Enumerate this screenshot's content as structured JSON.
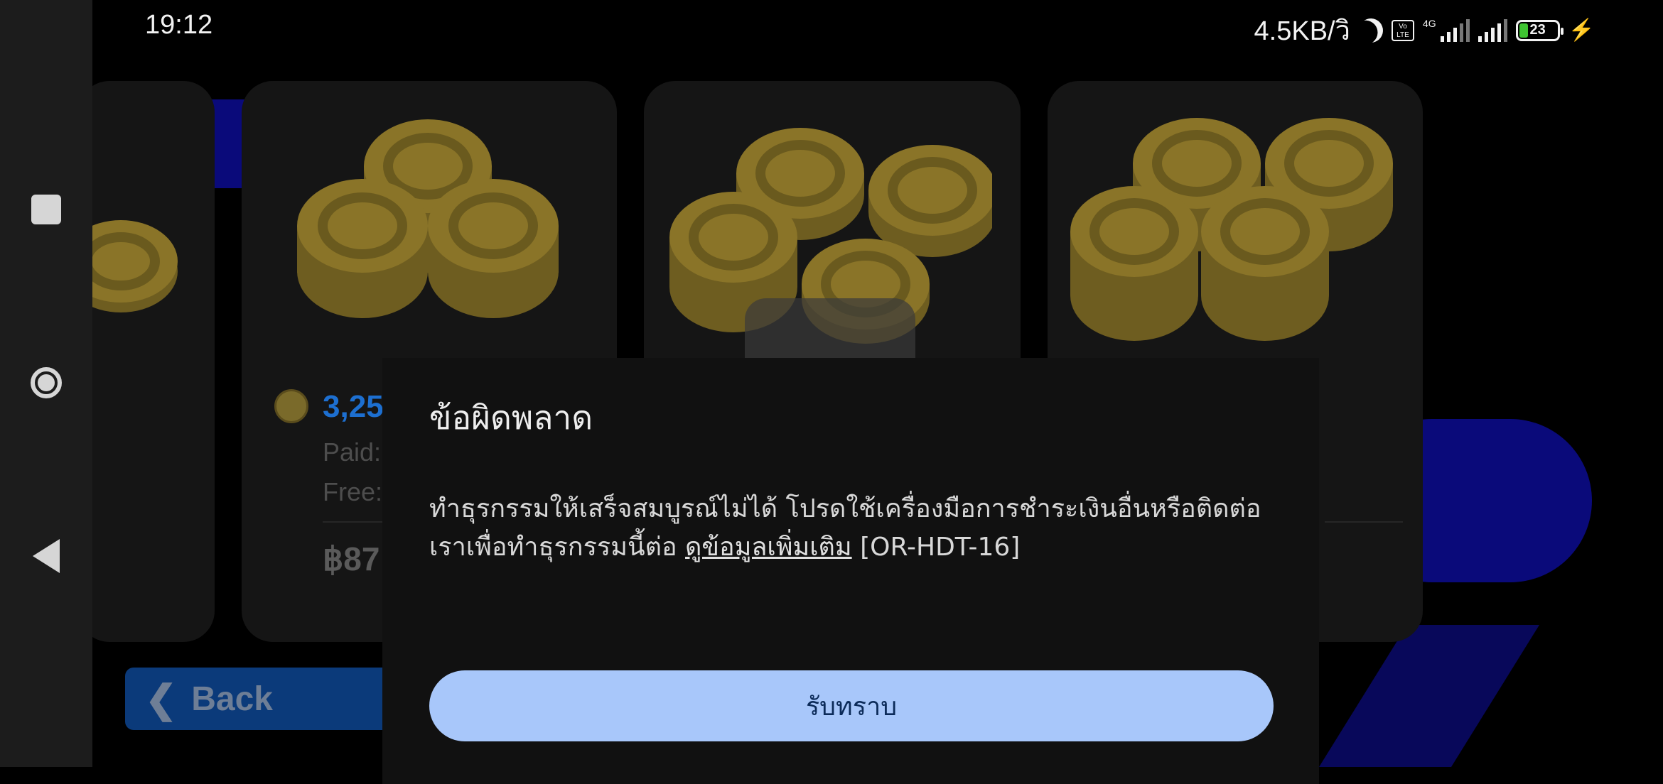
{
  "status_bar": {
    "time": "19:12",
    "net_speed": "4.5KB/วิ",
    "volte": "Vo LTE",
    "network_type": "4G",
    "battery_level": "23",
    "icons": [
      "moon-icon",
      "volte-icon",
      "signal-icon",
      "signal-icon",
      "battery-icon",
      "charging-icon"
    ]
  },
  "nav_bar": {
    "icons": [
      "recents-icon",
      "home-icon",
      "back-icon"
    ]
  },
  "shop": {
    "card_amount": "3,25",
    "paid_label": "Paid:",
    "free_label": "Free:",
    "price": "฿87",
    "back_label": "Back"
  },
  "dialog": {
    "title": "ข้อผิดพลาด",
    "message": "ทำธุรกรรมให้เสร็จสมบูรณ์ไม่ได้ โปรดใช้เครื่องมือการชำระเงินอื่นหรือติดต่อเราเพื่อทำธุรกรรมนี้ต่อ",
    "link_text": "ดูข้อมูลเพิ่มเติม",
    "error_code": "[OR-HDT-16]",
    "ok_label": "รับทราบ"
  },
  "colors": {
    "dialog_bg": "#111111",
    "button_bg": "#a8c7fa",
    "button_text": "#0b2a58",
    "coin_gold": "#8a7428"
  }
}
